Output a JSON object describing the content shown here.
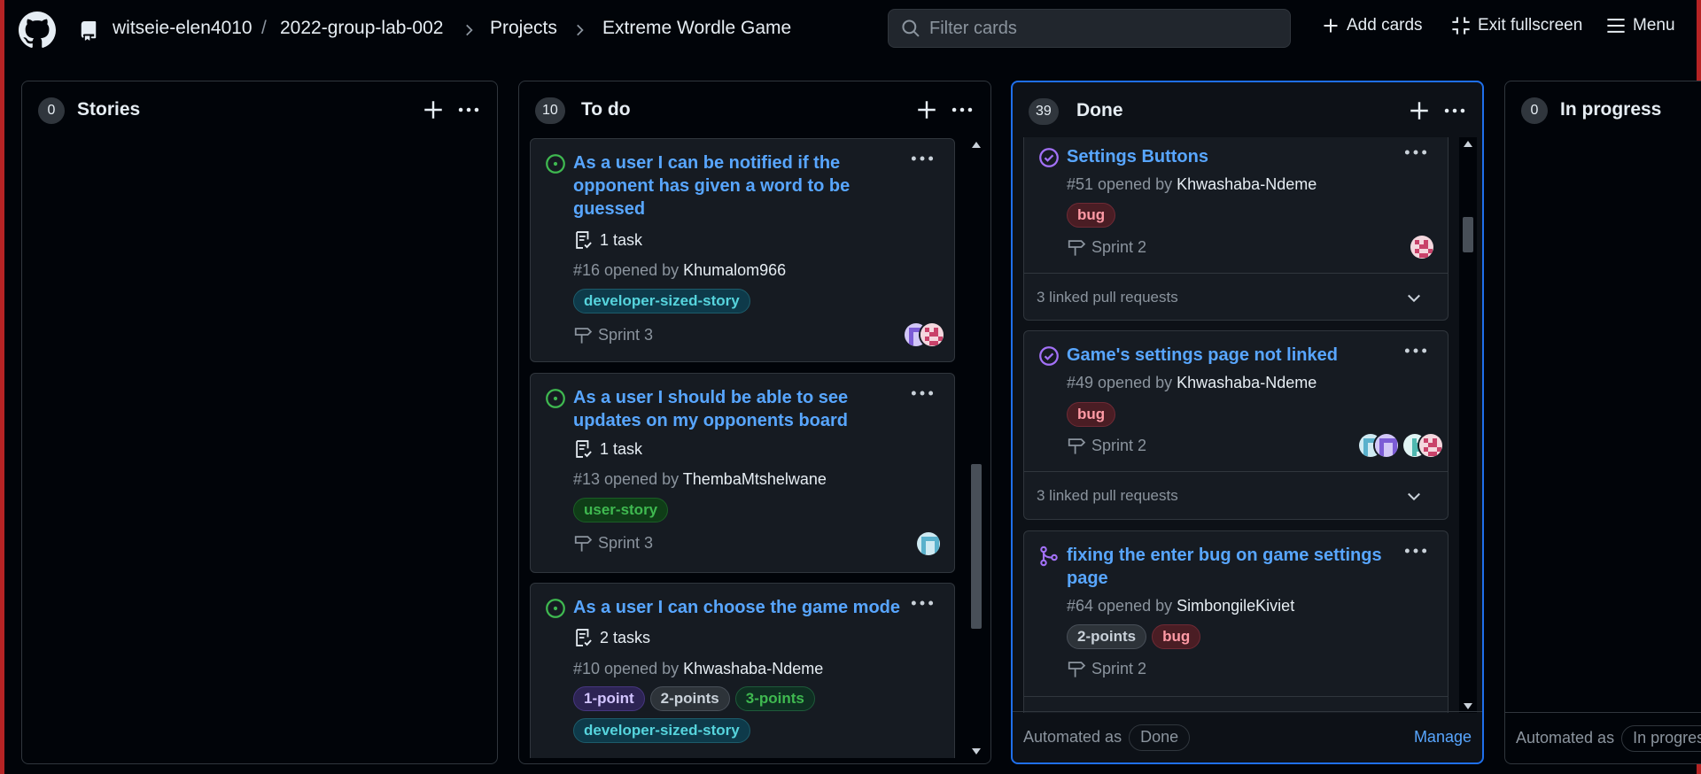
{
  "header": {
    "owner": "witseie-elen4010",
    "separator": "/",
    "repo": "2022-group-lab-002",
    "projects": "Projects",
    "project_name": "Extreme Wordle Game",
    "filter_placeholder": "Filter cards",
    "add_cards": "Add cards",
    "exit_fullscreen": "Exit fullscreen",
    "menu": "Menu"
  },
  "columns": [
    {
      "count": "0",
      "title": "Stories"
    },
    {
      "count": "10",
      "title": "To do",
      "cards": [
        {
          "title": "As a user I can be notified if the opponent has given a word to be guessed",
          "tasks": "1 task",
          "meta_prefix": "#16 opened by ",
          "author": "Khumalom966",
          "labels": [
            "developer-sized-story"
          ],
          "sprint": "Sprint 3"
        },
        {
          "title": "As a user I should be able to see updates on my opponents board",
          "tasks": "1 task",
          "meta_prefix": "#13 opened by ",
          "author": "ThembaMtshelwane",
          "labels": [
            "user-story"
          ],
          "sprint": "Sprint 3"
        },
        {
          "title": "As a user I can choose the game mode",
          "tasks": "2 tasks",
          "meta_prefix": "#10 opened by ",
          "author": "Khwashaba-Ndeme",
          "labels": [
            "1-point",
            "2-points",
            "3-points",
            "developer-sized-story"
          ]
        }
      ]
    },
    {
      "count": "39",
      "title": "Done",
      "cards": [
        {
          "title": "Settings Buttons",
          "meta_prefix": "#51 opened by ",
          "author": "Khwashaba-Ndeme",
          "labels": [
            "bug"
          ],
          "sprint": "Sprint 2",
          "linked": "3 linked pull requests"
        },
        {
          "title": "Game's settings page not linked",
          "meta_prefix": "#49 opened by ",
          "author": "Khwashaba-Ndeme",
          "labels": [
            "bug"
          ],
          "sprint": "Sprint 2",
          "linked": "3 linked pull requests"
        },
        {
          "title": "fixing the enter bug on game settings page",
          "meta_prefix": "#64 opened by ",
          "author": "SimbongileKiviet",
          "labels": [
            "2-points",
            "bug"
          ],
          "sprint": "Sprint 2"
        }
      ],
      "automated_as": "Automated as",
      "automation": "Done",
      "manage": "Manage"
    },
    {
      "count": "0",
      "title": "In progress",
      "automated_as": "Automated as",
      "automation": "In progress"
    }
  ],
  "colors": {
    "accent": "#58a6ff",
    "active_border": "#1f6feb",
    "open_issue": "#3fb950",
    "closed_issue": "#a371f7",
    "window_border": "#b62324"
  }
}
